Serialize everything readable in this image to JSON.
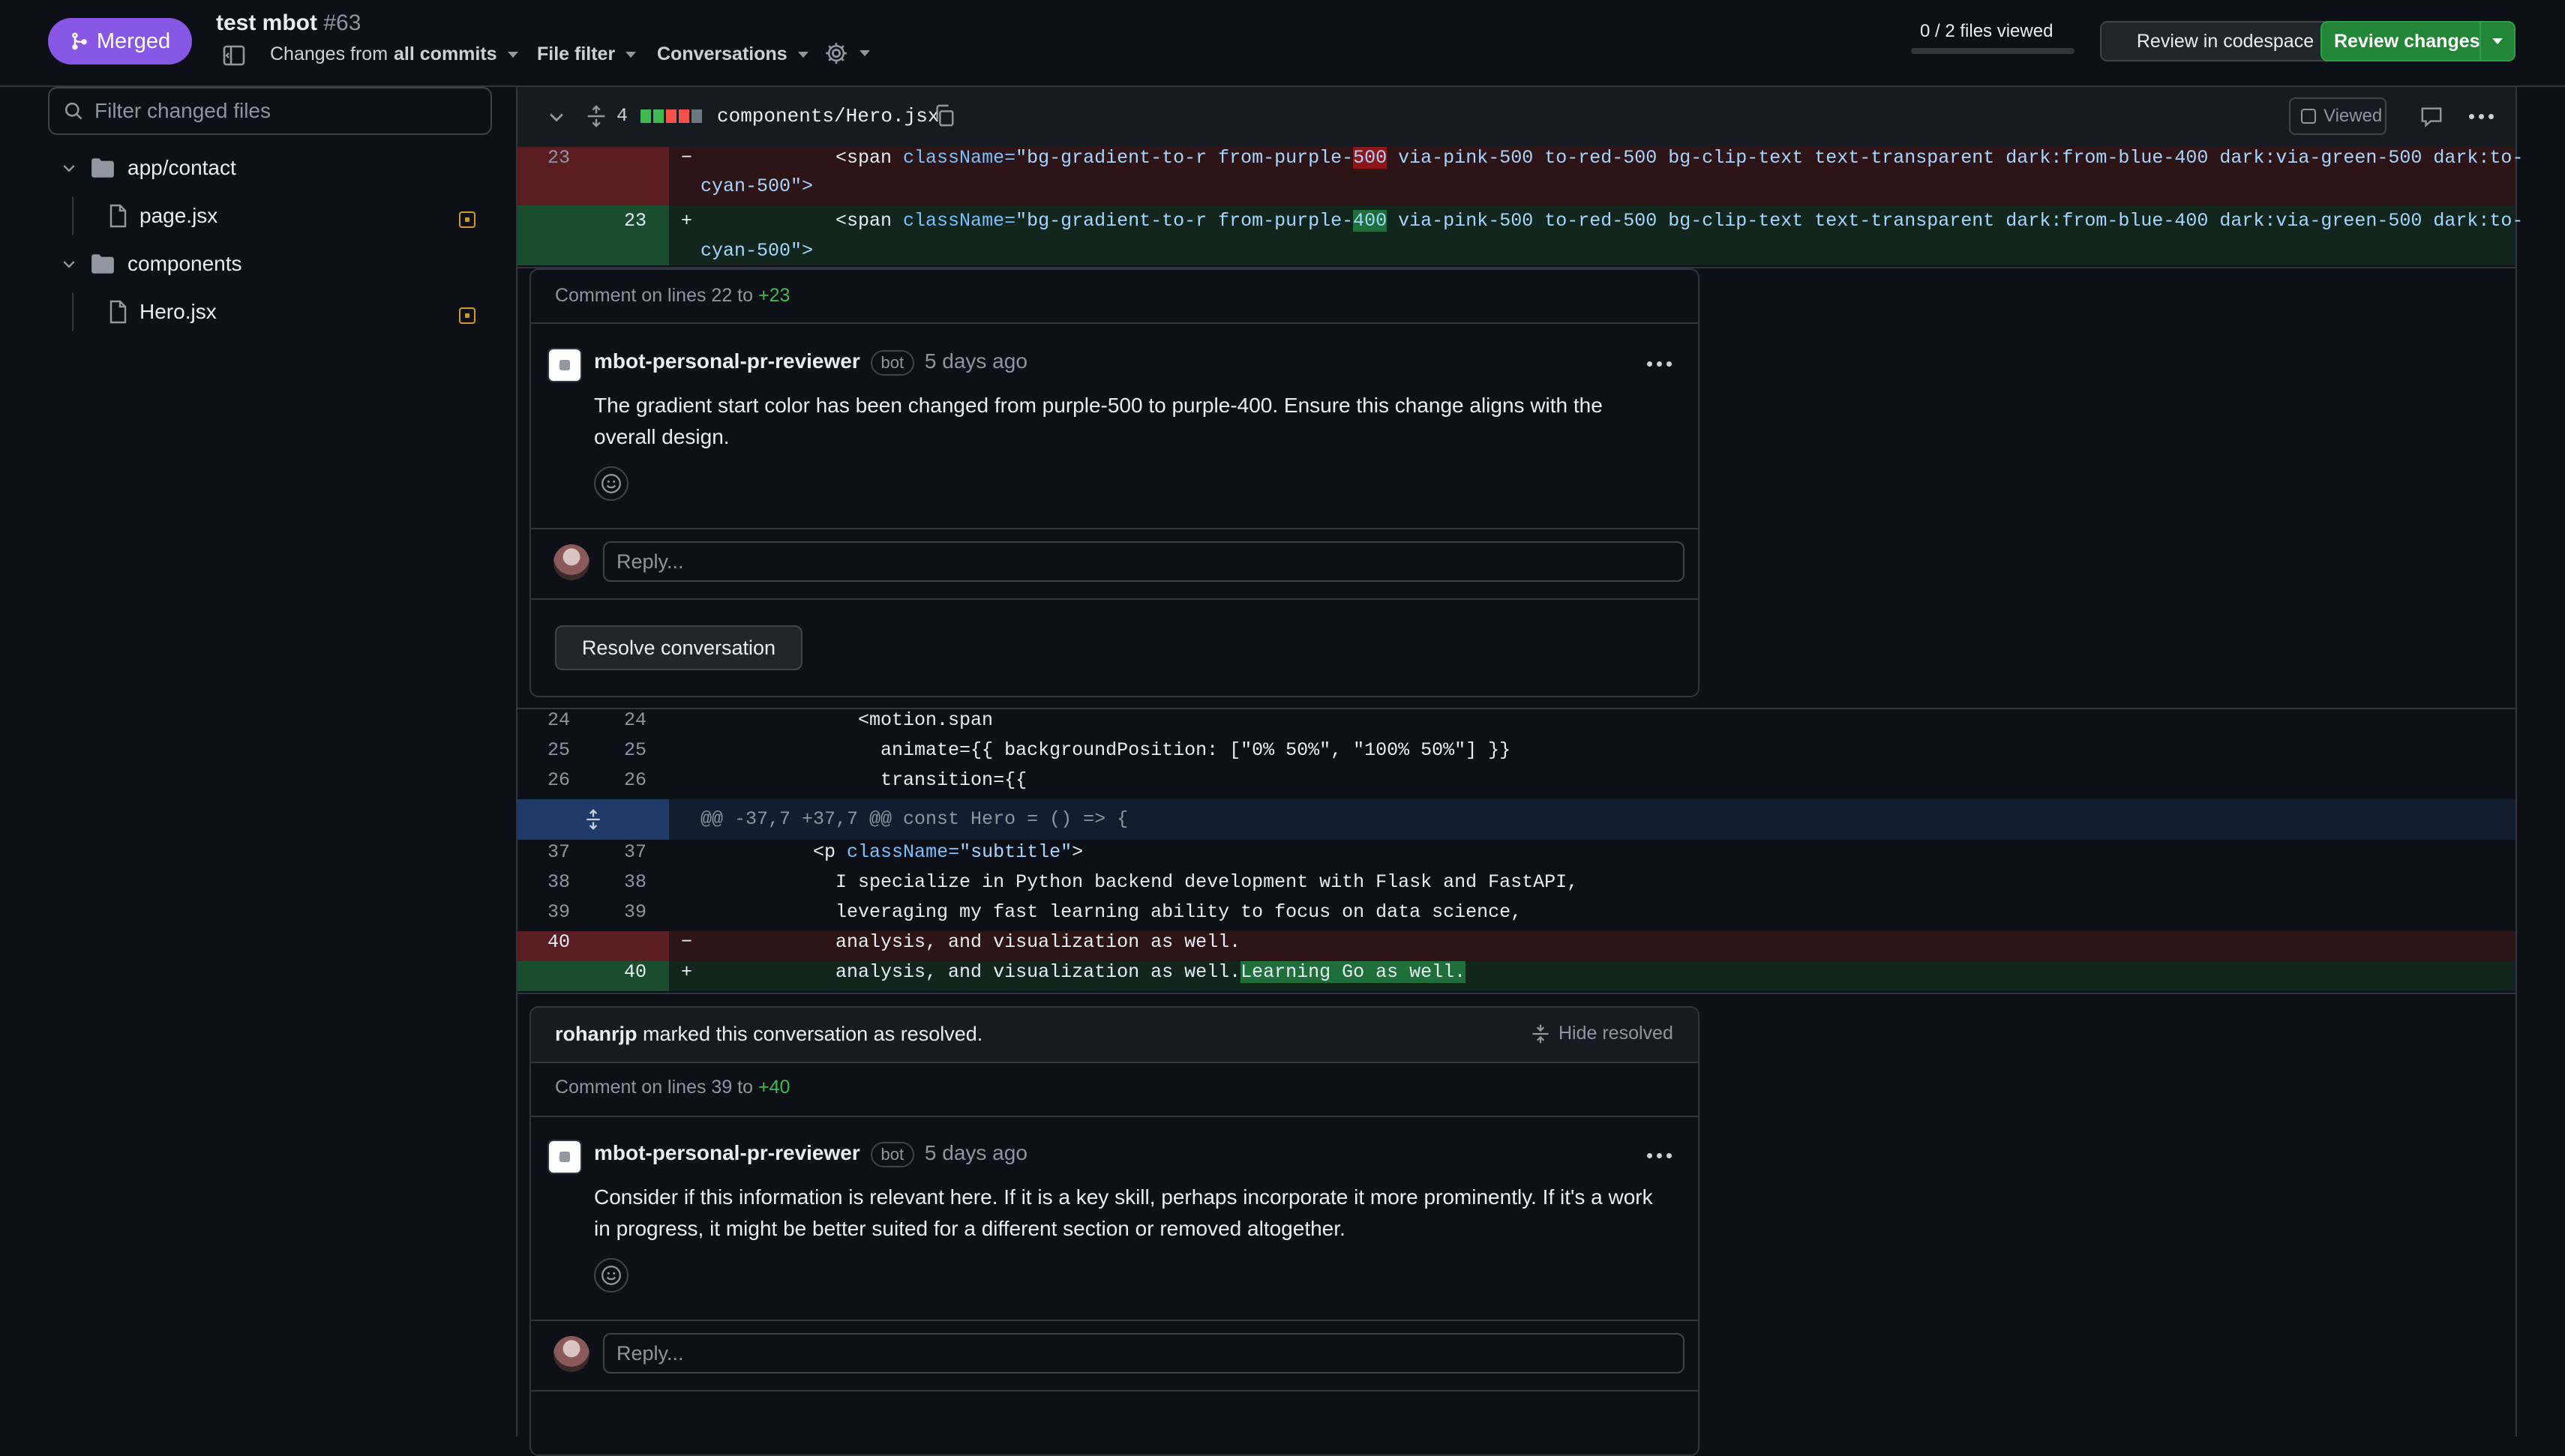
{
  "header": {
    "status_label": "Merged",
    "pr_title": "test mbot",
    "pr_number": "#63",
    "changes_prefix": "Changes from",
    "changes_value": "all commits",
    "file_filter": "File filter",
    "conversations": "Conversations",
    "files_viewed": "0 / 2 files viewed",
    "review_codespace": "Review in codespace",
    "review_changes": "Review changes"
  },
  "sidebar": {
    "filter_placeholder": "Filter changed files",
    "folders": [
      {
        "name": "app/contact",
        "files": [
          "page.jsx"
        ]
      },
      {
        "name": "components",
        "files": [
          "Hero.jsx"
        ]
      }
    ]
  },
  "file": {
    "changes_count": "4",
    "path": "components/Hero.jsx",
    "viewed_label": "Viewed"
  },
  "diff_top": {
    "del_line_no": "23",
    "del_sign": "−",
    "del_code_1_pre": "            <span ",
    "del_code_1_attr": "className=",
    "del_code_1_str_a": "\"bg-gradient-to-r from-purple-",
    "del_code_1_hl": "500",
    "del_code_1_str_b": " via-pink-500 to-red-500 bg-clip-text text-transparent dark:from-blue-400 dark:via-green-500 dark:to-",
    "del_code_2": "cyan-500\">",
    "add_line_no": "23",
    "add_sign": "+",
    "add_code_1_pre": "            <span ",
    "add_code_1_attr": "className=",
    "add_code_1_str_a": "\"bg-gradient-to-r from-purple-",
    "add_code_1_hl": "400",
    "add_code_1_str_b": " via-pink-500 to-red-500 bg-clip-text text-transparent dark:from-blue-400 dark:via-green-500 dark:to-",
    "add_code_2": "cyan-500\">"
  },
  "thread1": {
    "comment_on": "Comment on lines 22 to",
    "comment_on_end": "+23",
    "author": "mbot-personal-pr-reviewer",
    "badge": "bot",
    "time": "5 days ago",
    "body": "The gradient start color has been changed from purple-500 to purple-400. Ensure this change aligns with the overall design.",
    "reply_placeholder": "Reply...",
    "resolve_label": "Resolve conversation"
  },
  "context_lines": [
    {
      "old": "24",
      "new": "24",
      "code": "              <motion.span"
    },
    {
      "old": "25",
      "new": "25",
      "code": "                animate={{ backgroundPosition: [\"0% 50%\", \"100% 50%\"] }}"
    },
    {
      "old": "26",
      "new": "26",
      "code": "                transition={{"
    }
  ],
  "hunk_header": "@@ -37,7 +37,7 @@ const Hero = () => {",
  "context_lines_2": [
    {
      "old": "37",
      "new": "37",
      "code_pre": "          <p ",
      "code_attr": "className=",
      "code_str": "\"subtitle\"",
      "code_end": ">"
    },
    {
      "old": "38",
      "new": "38",
      "code": "            I specialize in Python backend development with Flask and FastAPI,"
    },
    {
      "old": "39",
      "new": "39",
      "code": "            leveraging my fast learning ability to focus on data science,"
    }
  ],
  "diff_bottom": {
    "del_line_no": "40",
    "del_sign": "−",
    "del_code": "            analysis, and visualization as well.",
    "add_line_no": "40",
    "add_sign": "+",
    "add_code": "            analysis, and visualization as well.",
    "add_hl": "Learning Go as well."
  },
  "thread2": {
    "resolved_user": "rohanrjp",
    "resolved_text": "marked this conversation as resolved.",
    "hide_resolved": "Hide resolved",
    "comment_on": "Comment on lines 39 to",
    "comment_on_end": "+40",
    "author": "mbot-personal-pr-reviewer",
    "badge": "bot",
    "time": "5 days ago",
    "body": "Consider if this information is relevant here. If it is a key skill, perhaps incorporate it more prominently. If it's a work in progress, it might be better suited for a different section or removed altogether.",
    "reply_placeholder": "Reply..."
  }
}
